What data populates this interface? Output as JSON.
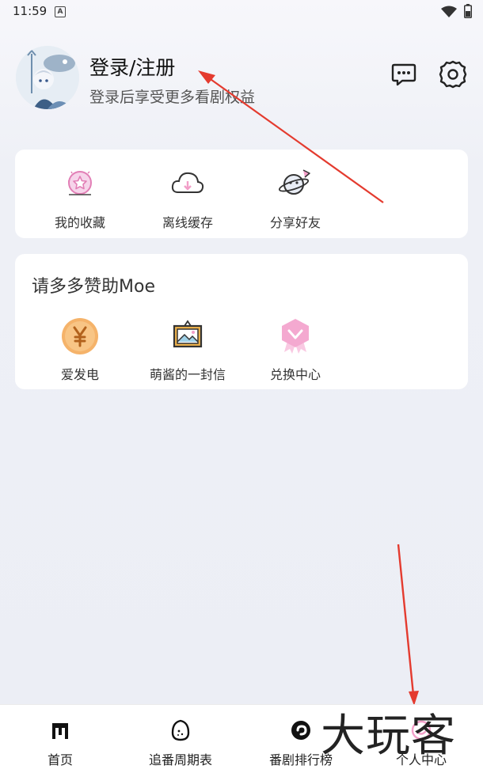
{
  "status_bar": {
    "time": "11:59",
    "a_badge": "A"
  },
  "profile": {
    "title": "登录/注册",
    "subtitle": "登录后享受更多看剧权益"
  },
  "quick_actions": [
    {
      "label": "我的收藏",
      "icon": "star-badge-icon"
    },
    {
      "label": "离线缓存",
      "icon": "cloud-download-icon"
    },
    {
      "label": "分享好友",
      "icon": "planet-share-icon"
    }
  ],
  "sponsor": {
    "title": "请多多赞助Moe",
    "items": [
      {
        "label": "爱发电",
        "icon": "yen-coin-icon"
      },
      {
        "label": "萌酱的一封信",
        "icon": "picture-frame-icon"
      },
      {
        "label": "兑换中心",
        "icon": "ribbon-badge-icon"
      }
    ]
  },
  "bottom_nav": [
    {
      "label": "首页",
      "icon": "home-m-icon"
    },
    {
      "label": "追番周期表",
      "icon": "egg-icon"
    },
    {
      "label": "番剧排行榜",
      "icon": "swirl-icon"
    },
    {
      "label": "个人中心",
      "icon": "profile-icon"
    }
  ],
  "watermark": "大玩客",
  "colors": {
    "accent_pink": "#f29ec8",
    "arrow_red": "#e43b2f",
    "coin": "#f5b36a"
  }
}
